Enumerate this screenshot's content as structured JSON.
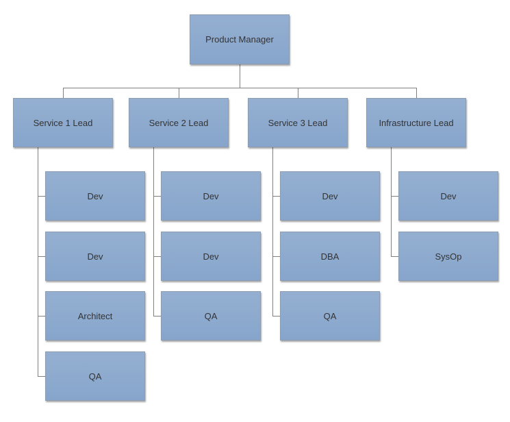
{
  "diagram": {
    "type": "org-chart",
    "root": {
      "label": "Product Manager"
    },
    "leads": [
      {
        "label": "Service 1 Lead",
        "reports": [
          "Dev",
          "Dev",
          "Architect",
          "QA"
        ]
      },
      {
        "label": "Service 2 Lead",
        "reports": [
          "Dev",
          "Dev",
          "QA"
        ]
      },
      {
        "label": "Service 3 Lead",
        "reports": [
          "Dev",
          "DBA",
          "QA"
        ]
      },
      {
        "label": "Infrastructure Lead",
        "reports": [
          "Dev",
          "SysOp"
        ]
      }
    ],
    "colors": {
      "box_fill": "#8faacd",
      "box_border": "#8c9db3",
      "connector": "#7f7f7f",
      "text": "#333333"
    }
  }
}
